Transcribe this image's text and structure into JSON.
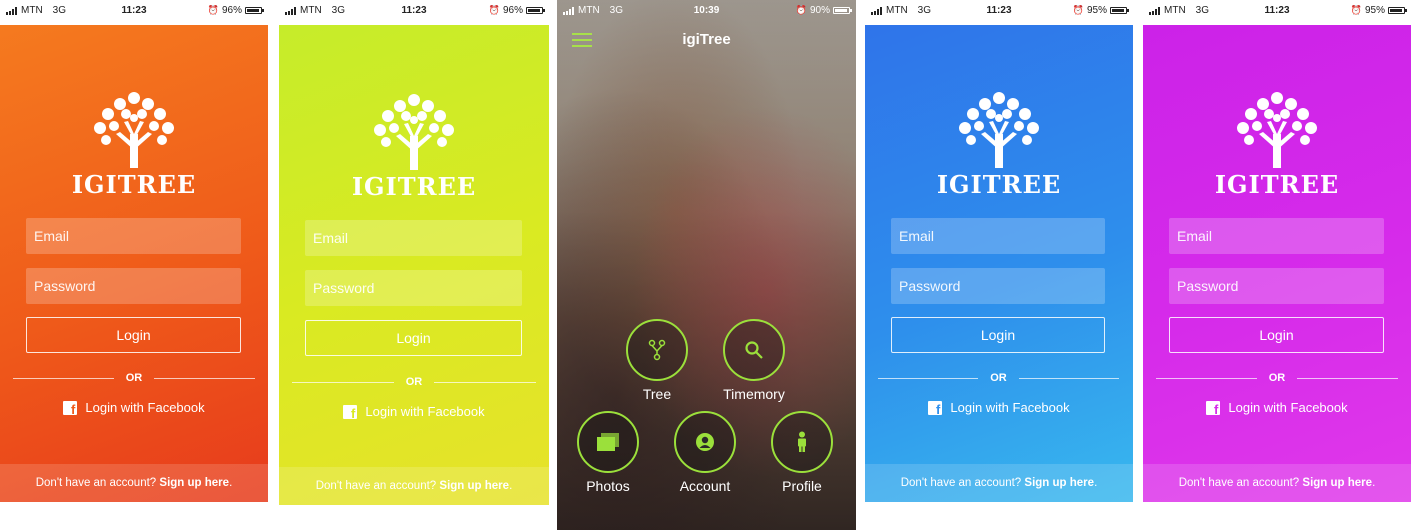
{
  "screens": {
    "orange": {
      "status": {
        "carrier": "MTN",
        "network": "3G",
        "time": "11:23",
        "battery": "96%"
      },
      "logo": "IGITREE",
      "email_placeholder": "Email",
      "password_placeholder": "Password",
      "login_label": "Login",
      "or_label": "OR",
      "facebook_label": "Login with Facebook",
      "footer_text": "Don't have an account?",
      "footer_link": "Sign up here",
      "footer_end": "."
    },
    "yellow": {
      "status": {
        "carrier": "MTN",
        "network": "3G",
        "time": "11:23",
        "battery": "96%"
      },
      "logo": "IGITREE",
      "email_placeholder": "Email",
      "password_placeholder": "Password",
      "login_label": "Login",
      "or_label": "OR",
      "facebook_label": "Login with Facebook",
      "footer_text": "Don't have an account?",
      "footer_link": "Sign up here",
      "footer_end": "."
    },
    "home": {
      "status": {
        "carrier": "MTN",
        "network": "3G",
        "time": "10:39",
        "battery": "90%"
      },
      "title": "igiTree",
      "menu": [
        {
          "label": "Tree",
          "icon": "tree-branch-icon"
        },
        {
          "label": "Timemory",
          "icon": "search-icon"
        },
        {
          "label": "Photos",
          "icon": "photos-icon"
        },
        {
          "label": "Account",
          "icon": "account-icon"
        },
        {
          "label": "Profile",
          "icon": "person-icon"
        }
      ]
    },
    "blue": {
      "status": {
        "carrier": "MTN",
        "network": "3G",
        "time": "11:23",
        "battery": "95%"
      },
      "logo": "IGITREE",
      "email_placeholder": "Email",
      "password_placeholder": "Password",
      "login_label": "Login",
      "or_label": "OR",
      "facebook_label": "Login with Facebook",
      "footer_text": "Don't have an account?",
      "footer_link": "Sign up here",
      "footer_end": "."
    },
    "purple": {
      "status": {
        "carrier": "MTN",
        "network": "3G",
        "time": "11:23",
        "battery": "95%"
      },
      "logo": "IGITREE",
      "email_placeholder": "Email",
      "password_placeholder": "Password",
      "login_label": "Login",
      "or_label": "OR",
      "facebook_label": "Login with Facebook",
      "footer_text": "Don't have an account?",
      "footer_link": "Sign up here",
      "footer_end": "."
    }
  },
  "colors": {
    "orange": "#ef5a1a",
    "yellow": "#d9ea22",
    "blue": "#2e8fec",
    "purple": "#d62bea",
    "menu_ring": "#9be03b"
  }
}
